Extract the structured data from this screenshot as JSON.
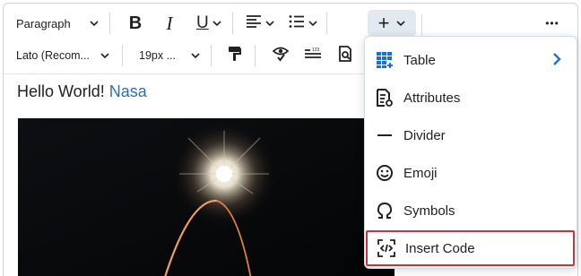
{
  "toolbar": {
    "block_format": "Paragraph",
    "font_family": "Lato (Recom...",
    "font_size": "19px ...",
    "bold_glyph": "B",
    "italic_glyph": "I",
    "underline_glyph": "U",
    "insert_glyph": "+",
    "more_glyph": "•••"
  },
  "editor": {
    "text": "Hello World!",
    "link_text": "Nasa"
  },
  "insert_menu": {
    "items": [
      {
        "label": "Table",
        "icon": "table-icon",
        "has_submenu": true
      },
      {
        "label": "Attributes",
        "icon": "attributes-icon"
      },
      {
        "label": "Divider",
        "icon": "divider-icon"
      },
      {
        "label": "Emoji",
        "icon": "emoji-icon"
      },
      {
        "label": "Symbols",
        "icon": "symbols-icon"
      },
      {
        "label": "Insert Code",
        "icon": "insert-code-icon",
        "highlighted": true
      }
    ]
  },
  "colors": {
    "link": "#2e6fb0",
    "table_icon": "#1f6fd1",
    "highlight_border": "#c8343c",
    "active_button_bg": "#e3e9f1"
  }
}
